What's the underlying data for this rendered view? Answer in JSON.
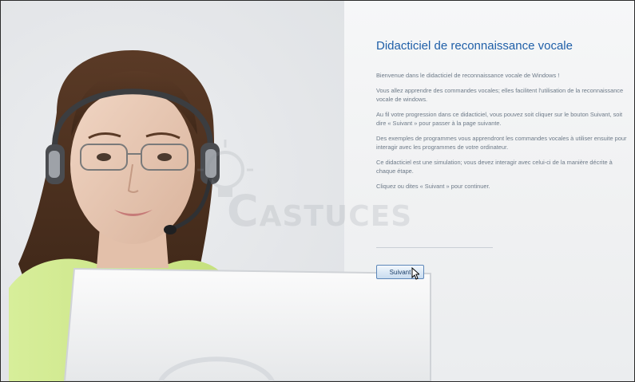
{
  "tutorial": {
    "title": "Didacticiel de reconnaissance vocale",
    "paragraphs": [
      "Bienvenue dans le didacticiel de reconnaissance vocale de Windows !",
      "Vous allez apprendre des commandes vocales; elles facilitent l'utilisation de la reconnaissance vocale de windows.",
      "Au fil votre progression dans ce didacticiel, vous pouvez soit cliquer sur le bouton Suivant, soit dire « Suivant » pour passer à la page suivante.",
      "Des exemples de programmes vous apprendront les commandes vocales à utiliser ensuite pour interagir avec les programmes de votre ordinateur.",
      "Ce didacticiel est une simulation; vous devez interagir avec celui-ci de la manière décrite à chaque étape.",
      "Cliquez ou dites « Suivant » pour continuer."
    ],
    "next_button": "Suivant"
  },
  "watermark": {
    "text": "ASTUCES",
    "initial": "C"
  },
  "colors": {
    "title": "#1f5fa8",
    "body_text": "#6d7a88",
    "button_border": "#5c86b8"
  }
}
